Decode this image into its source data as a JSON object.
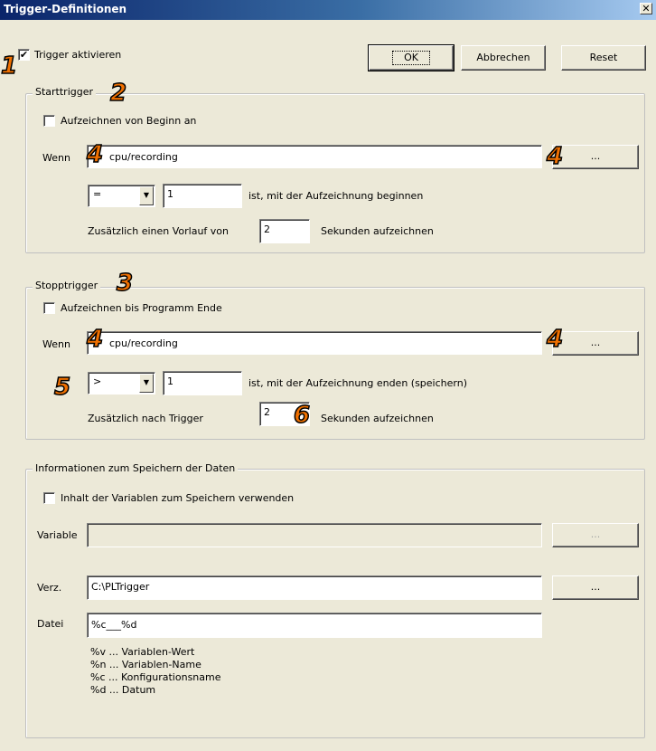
{
  "window": {
    "title": "Trigger-Definitionen",
    "close_glyph": "✕"
  },
  "top": {
    "trigger_checkbox_label": "Trigger aktivieren",
    "trigger_checked": true,
    "ok_label": "OK",
    "cancel_label": "Abbrechen",
    "reset_label": "Reset"
  },
  "start": {
    "legend": "Starttrigger",
    "from_start_label": "Aufzeichnen von Beginn an",
    "wenn_label": "Wenn",
    "wenn_value": "cpu/recording",
    "browse_label": "...",
    "operator": "=",
    "value": "1",
    "condition_text": "ist, mit der Aufzeichnung beginnen",
    "prerun_label": "Zusätzlich einen Vorlauf von",
    "prerun_value": "2",
    "prerun_suffix": "Sekunden aufzeichnen"
  },
  "stop": {
    "legend": "Stopptrigger",
    "until_end_label": "Aufzeichnen bis Programm Ende",
    "wenn_label": "Wenn",
    "wenn_value": "cpu/recording",
    "browse_label": "...",
    "operator": ">",
    "value": "1",
    "condition_text": "ist, mit der Aufzeichnung enden (speichern)",
    "after_label": "Zusätzlich nach Trigger",
    "after_value": "2",
    "after_suffix": "Sekunden aufzeichnen"
  },
  "save": {
    "legend": "Informationen zum Speichern der Daten",
    "use_var_label": "Inhalt der Variablen zum Speichern verwenden",
    "variable_label": "Variable",
    "variable_value": "",
    "variable_browse": "...",
    "dir_label": "Verz.",
    "dir_value": "C:\\PLTrigger",
    "dir_browse": "...",
    "file_label": "Datei",
    "file_value": "%c___%d",
    "help": [
      "%v ... Variablen-Wert",
      "%n ... Variablen-Name",
      "%c ... Konfigurationsname",
      "%d ... Datum"
    ]
  },
  "markers": [
    "1",
    "2",
    "3",
    "4",
    "4",
    "4",
    "4",
    "5",
    "6"
  ],
  "colors": {
    "marker": "#f07000",
    "titlebar_start": "#0a246a",
    "dialog_bg": "#ece9d8"
  }
}
